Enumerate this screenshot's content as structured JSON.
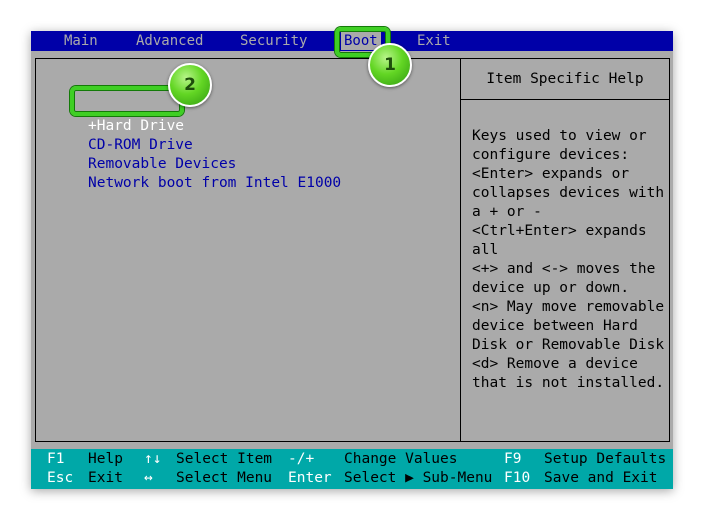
{
  "menu": {
    "items": [
      "Main",
      "Advanced",
      "Security",
      "Boot",
      "Exit"
    ],
    "active": "Boot"
  },
  "boot_order": {
    "items": [
      "+Hard Drive",
      "CD-ROM Drive",
      "Removable Devices",
      "Network boot from Intel E1000"
    ],
    "selected_index": 0
  },
  "help": {
    "title": "Item Specific Help",
    "text": "Keys used to view or\nconfigure devices:\n<Enter> expands or\ncollapses devices with\na + or -\n<Ctrl+Enter> expands\nall\n<+> and <-> moves the\ndevice up or down.\n<n> May move removable\ndevice between Hard\nDisk or Removable Disk\n<d> Remove a device\nthat is not installed."
  },
  "footer": {
    "row1": [
      {
        "key": "F1",
        "desc": "Help"
      },
      {
        "key": "↑↓",
        "desc": "Select Item"
      },
      {
        "key": "-/+",
        "desc": "Change Values"
      },
      {
        "key": "F9",
        "desc": "Setup Defaults"
      }
    ],
    "row2": [
      {
        "key": "Esc",
        "desc": "Exit"
      },
      {
        "key": "↔",
        "desc": "Select Menu"
      },
      {
        "key": "Enter",
        "desc": "Select ▶ Sub-Menu"
      },
      {
        "key": "F10",
        "desc": "Save and Exit"
      }
    ]
  },
  "annotations": [
    "1",
    "2"
  ],
  "colors": {
    "background": "#aaaaaa",
    "menu_bar": "#0000a8",
    "footer_bar": "#00a8a8",
    "item_text": "#0000a8",
    "selected_text": "#ffffff",
    "highlight": "#3fcf24"
  }
}
